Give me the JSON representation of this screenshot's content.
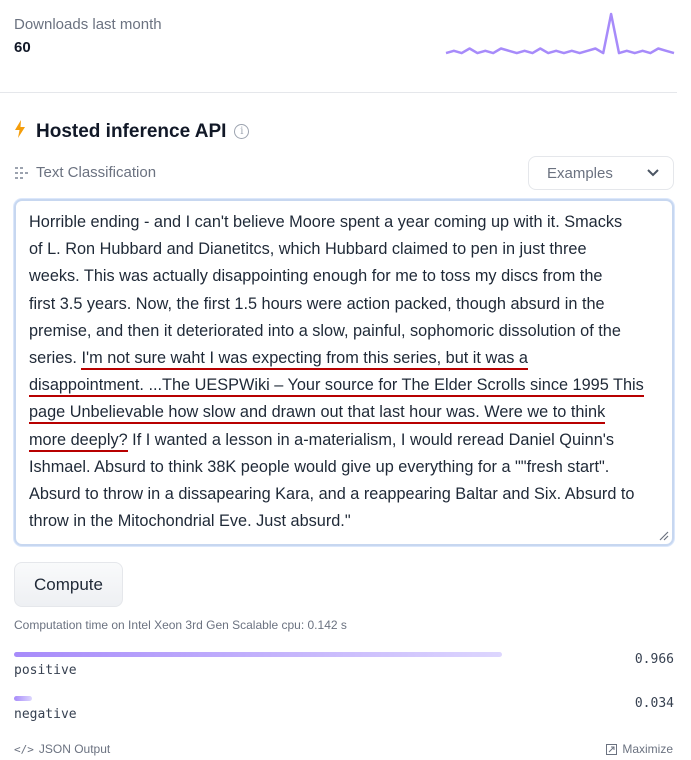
{
  "downloads": {
    "label": "Downloads last month",
    "count": "60"
  },
  "api": {
    "title": "Hosted inference API",
    "info_icon": "info-icon",
    "bolt_icon": "lightning-icon"
  },
  "task": {
    "label": "Text Classification",
    "icon": "text-classification-icon"
  },
  "examples": {
    "label": "Examples",
    "icon": "chevron-down-icon"
  },
  "input_text": {
    "lines": [
      "Horrible ending - and I can't believe Moore spent a year coming up with it. Smacks",
      "of L. Ron Hubbard and Dianetitcs, which Hubbard claimed to pen in just three",
      "weeks. This was actually disappointing enough for me to toss my discs from the",
      "first 3.5 years. Now, the first 1.5 hours were action packed, though absurd in the",
      "premise, and then it deteriorated into a slow, painful, sophomoric dissolution of the",
      [
        "series. ",
        "I'm not sure waht I was expecting from this series, but it was a"
      ],
      [
        "",
        "disappointment.  ...The UESPWiki – Your source for The Elder Scrolls since 1995 This"
      ],
      [
        "",
        "page Unbelievable how slow and drawn out that last hour was. Were we to think"
      ],
      [
        "",
        "more deeply?",
        " If I wanted a lesson in a-materialism, I would reread Daniel Quinn's"
      ],
      "Ishmael. Absurd to think 38K people would give up everything for a \"\"fresh start\".",
      "Absurd to throw in a dissapearing Kara, and a reappearing Baltar and Six. Absurd to",
      "throw in the Mitochondrial Eve. Just absurd.\""
    ]
  },
  "compute_button": {
    "label": "Compute"
  },
  "computation_time": "Computation time on Intel Xeon 3rd Gen Scalable cpu: 0.142 s",
  "results": [
    {
      "label": "positive",
      "score": "0.966",
      "fraction": 0.966
    },
    {
      "label": "negative",
      "score": "0.034",
      "fraction": 0.034
    }
  ],
  "footer": {
    "json_output": "JSON Output",
    "maximize": "Maximize"
  },
  "colors": {
    "accent_purple": "#a78bfa",
    "underline_red": "#b80000",
    "bolt_orange": "#f59e0b"
  },
  "sparkline_values": [
    3,
    4,
    3,
    5,
    3,
    4,
    3,
    5,
    4,
    3,
    4,
    3,
    5,
    3,
    4,
    3,
    4,
    3,
    4,
    5,
    3,
    20,
    3,
    4,
    3,
    4,
    3,
    5,
    4,
    3
  ]
}
